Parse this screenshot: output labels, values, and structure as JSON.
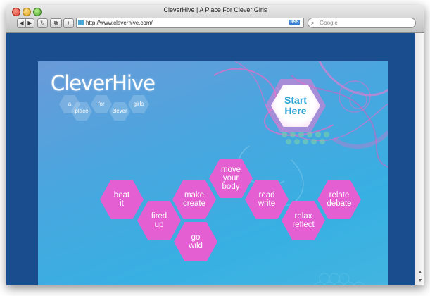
{
  "window": {
    "title": "CleverHive | A Place For Clever Girls"
  },
  "toolbar": {
    "back_label": "◀",
    "forward_label": "▶",
    "reload_label": "↻",
    "tabs_label": "⧉",
    "add_label": "+",
    "url": "http://www.cleverhive.com/",
    "rss_label": "RSS",
    "search_placeholder": "Google",
    "search_icon": "magnifier-icon"
  },
  "site": {
    "logo": "CleverHive",
    "tagline_words": [
      "a",
      "place",
      "for",
      "clever",
      "girls"
    ],
    "start_button": [
      "Start",
      "Here"
    ],
    "hexes": [
      {
        "key": "beat-it",
        "lines": [
          "beat",
          "it"
        ]
      },
      {
        "key": "fired-up",
        "lines": [
          "fired",
          "up"
        ]
      },
      {
        "key": "make-create",
        "lines": [
          "make",
          "create"
        ]
      },
      {
        "key": "go-wild",
        "lines": [
          "go",
          "wild"
        ]
      },
      {
        "key": "move-your-body",
        "lines": [
          "move",
          "your",
          "body"
        ]
      },
      {
        "key": "read-write",
        "lines": [
          "read",
          "write"
        ]
      },
      {
        "key": "relax-reflect",
        "lines": [
          "relax",
          "reflect"
        ]
      },
      {
        "key": "relate-debate",
        "lines": [
          "relate",
          "debate"
        ]
      }
    ]
  },
  "colors": {
    "hex_pink": "#e45fd2",
    "background_blue": "#37b0e2",
    "frame_navy": "#1a4d8e",
    "start_text": "#2aa3d6"
  }
}
